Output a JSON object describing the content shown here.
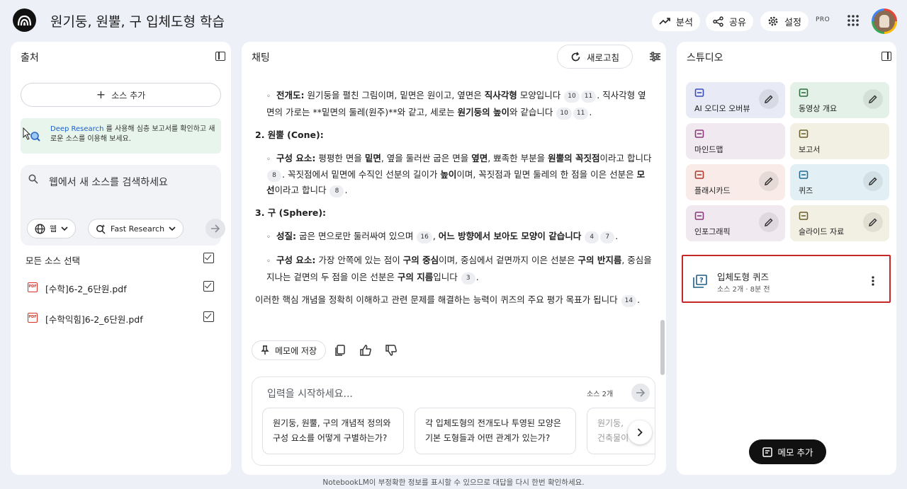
{
  "header": {
    "title": "원기둥, 원뿔, 구 입체도형 학습",
    "analyze_label": "분석",
    "share_label": "공유",
    "settings_label": "설정",
    "pro_badge": "PRO"
  },
  "sources": {
    "title": "출처",
    "add_label": "소스 추가",
    "deep_research": {
      "link": "Deep Research",
      "text": "를 사용해 심층 보고서를 확인하고 새로운 소스를 이용해 보세요."
    },
    "search_placeholder": "웹에서 새 소스를 검색하세요",
    "web_chip": "웹",
    "fast_research_chip": "Fast Research",
    "select_all_label": "모든 소스 선택",
    "files": [
      {
        "name": "[수학]6-2_6단원.pdf",
        "checked": true
      },
      {
        "name": "[수학익힘]6-2_6단원.pdf",
        "checked": true
      }
    ]
  },
  "chat": {
    "title": "채팅",
    "refresh_label": "새로고침",
    "paragraphs": {
      "p1_label": "전개도:",
      "p1_a": "원기둥을 펼친 그림이며, 밑면은 원이고, 옆면은",
      "p1_b": "직사각형",
      "p1_c": "모양입니다",
      "p1_d": ". 직사각형 옆면의 가로는 **밑면의 둘레(원주)**와 같고, 세로는",
      "p1_e": "원기둥의 높이",
      "p1_f": "와 같습니다",
      "h2": "2. 원뿔 (Cone):",
      "p2_label": "구성 요소:",
      "p2_a": "평평한 면을",
      "p2_b": "밑면",
      "p2_c": ", 옆을 둘러싼 굽은 면을",
      "p2_d": "옆면",
      "p2_e": ", 뾰족한 부분을",
      "p2_f": "원뿔의 꼭짓점",
      "p2_g": "이라고 합니다",
      "p2_h": ". 꼭짓점에서 밑면에 수직인 선분의 길이가",
      "p2_i": "높이",
      "p2_j": "이며, 꼭짓점과 밑면 둘레의 한 점을 이은 선분은",
      "p2_k": "모선",
      "p2_l": "이라고 합니다",
      "h3": "3. 구 (Sphere):",
      "p3_label": "성질:",
      "p3_a": "굽은 면으로만 둘러싸여 있으며",
      "p3_b": "어느 방향에서 보아도 모양이 같습니다",
      "p4_label": "구성 요소:",
      "p4_a": "가장 안쪽에 있는 점이",
      "p4_b": "구의 중심",
      "p4_c": "이며, 중심에서 겉면까지 이은 선분은",
      "p4_d": "구의 반지름",
      "p4_e": ", 중심을 지나는 겉면의 두 점을 이은 선분은",
      "p4_f": "구의 지름",
      "p4_g": "입니다",
      "p5": "이러한 핵심 개념을 정확히 이해하고 관련 문제를 해결하는 능력이 퀴즈의 주요 평가 목표가 됩니다"
    },
    "citations": {
      "c10": "10",
      "c11": "11",
      "c8": "8",
      "c16": "16",
      "c4": "4",
      "c7": "7",
      "c3": "3",
      "c14": "14"
    },
    "save_memo_label": "메모에 저장",
    "input_placeholder": "입력을 시작하세요...",
    "source_count": "소스 2개",
    "suggestions": [
      {
        "line1": "원기둥, 원뿔, 구의 개념적 정의와",
        "line2": "구성 요소를 어떻게 구별하는가?"
      },
      {
        "line1": "각 입체도형의 전개도나 투영된 모양은",
        "line2": "기본 도형들과 어떤 관계가 있는가?"
      },
      {
        "line1": "원기둥,",
        "line2": "건축물이"
      }
    ]
  },
  "studio": {
    "title": "스튜디오",
    "tiles": [
      {
        "label": "AI 오디오 오버뷰",
        "icon": "audio-wave-icon",
        "bg": "#e8ebf6",
        "accent": "#3b4cb8"
      },
      {
        "label": "동영상 개요",
        "icon": "video-icon",
        "bg": "#e4f1e8",
        "accent": "#2d6e3e"
      },
      {
        "label": "마인드맵",
        "icon": "mindmap-icon",
        "bg": "#f1e9f0",
        "accent": "#8a3a7a"
      },
      {
        "label": "보고서",
        "icon": "report-icon",
        "bg": "#f2f0e2",
        "accent": "#6b5f2a"
      },
      {
        "label": "플래시카드",
        "icon": "flashcard-icon",
        "bg": "#f8ebe8",
        "accent": "#b03a2e"
      },
      {
        "label": "퀴즈",
        "icon": "quiz-icon",
        "bg": "#e2f0f6",
        "accent": "#1f6e95"
      },
      {
        "label": "인포그래픽",
        "icon": "infographic-icon",
        "bg": "#f1e9f0",
        "accent": "#8a3a7a"
      },
      {
        "label": "슬라이드 자료",
        "icon": "slides-icon",
        "bg": "#f2f0e2",
        "accent": "#6b5f2a"
      }
    ],
    "generated": {
      "title": "입체도형 퀴즈",
      "meta": "소스 2개 · 8분 전"
    },
    "add_note_label": "메모 추가"
  },
  "footer": {
    "disclaimer": "NotebookLM이 부정확한 정보를 표시할 수 있으므로 대답을 다시 한번 확인하세요."
  }
}
